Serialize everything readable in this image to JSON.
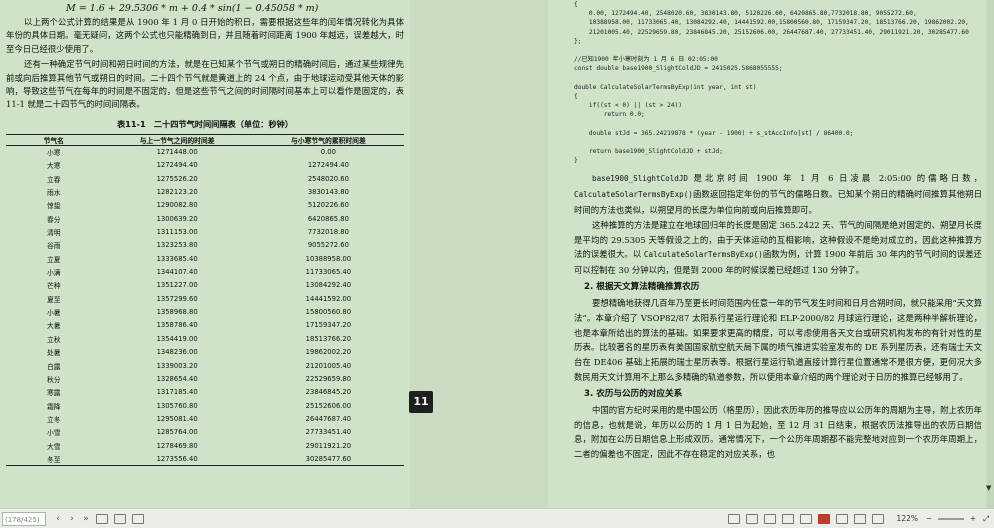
{
  "left_page": {
    "formula": "M = 1.6 + 29.5306 * m + 0.4 * sin(1 − 0.45058 * m)",
    "para1": "以上两个公式计算的结果是从 1900 年 1 月 0 日开始的积日，需要根据这些年的闰年情况转化为具体年份的具体日期。毫无疑问，这两个公式也只能精确到日，并且随着时间距离 1900 年越远，误差越大，时至今日已经很少使用了。",
    "para2": "还有一种确定节气时间和朔日时间的方法，就是在已知某个节气或朔日的精确时间后，通过某些规律先前或向后推算其他节气或朔日的时间。二十四个节气就是黄道上的 24 个点，由于地球运动受其他天体的影响，导致这些节气在每年的时间是不固定的，但是这些节气之间的时间隔时间基本上可以看作是固定的，表 11-1 就是二十四节气的时间间隔表。",
    "table_title": "表11-1　二十四节气时间间隔表（单位：秒钟）",
    "table_headers": [
      "节气名",
      "与上一节气之间的时间差",
      "与小寒节气的累积时间差"
    ],
    "table_rows": [
      [
        "小寒",
        "1271448.00",
        "0.00"
      ],
      [
        "大寒",
        "1272494.40",
        "1272494.40"
      ],
      [
        "立春",
        "1275526.20",
        "2548020.60"
      ],
      [
        "雨水",
        "1282123.20",
        "3830143.80"
      ],
      [
        "惊蛰",
        "1290082.80",
        "5120226.60"
      ],
      [
        "春分",
        "1300639.20",
        "6420865.80"
      ],
      [
        "清明",
        "1311153.00",
        "7732018.80"
      ],
      [
        "谷雨",
        "1323253.80",
        "9055272.60"
      ],
      [
        "立夏",
        "1333685.40",
        "10388958.00"
      ],
      [
        "小满",
        "1344107.40",
        "11733065.40"
      ],
      [
        "芒种",
        "1351227.00",
        "13084292.40"
      ],
      [
        "夏至",
        "1357299.60",
        "14441592.00"
      ],
      [
        "小暑",
        "1358968.80",
        "15800560.80"
      ],
      [
        "大暑",
        "1358786.40",
        "17159347.20"
      ],
      [
        "立秋",
        "1354419.00",
        "18513766.20"
      ],
      [
        "处暑",
        "1348236.00",
        "19862002.20"
      ],
      [
        "白露",
        "1339003.20",
        "21201005.40"
      ],
      [
        "秋分",
        "1328654.40",
        "22529659.80"
      ],
      [
        "寒露",
        "1317185.40",
        "23846845.20"
      ],
      [
        "霜降",
        "1305760.80",
        "25152606.00"
      ],
      [
        "立冬",
        "1295081.40",
        "26447687.40"
      ],
      [
        "小雪",
        "1285764.00",
        "27733451.40"
      ],
      [
        "大雪",
        "1278469.80",
        "29011921.20"
      ],
      [
        "冬至",
        "1273556.40",
        "30285477.60"
      ]
    ]
  },
  "page_badge": "11",
  "right_page": {
    "code_lines": [
      "{",
      "    0.00, 1272494.40, 2548020.60, 3830143.80, 5120226.60, 6420865.80,7732018.80, 9055272.60,",
      "    10388958.00, 11733065.40, 13084292.40, 14441592.00,15800560.80, 17159347.20, 18513766.20, 19862002.20,",
      "    21201005.40, 22529659.80, 23846845.20, 25152606.00, 26447687.40, 27733451.40, 29011921.20, 30285477.60",
      "};",
      "",
      "//已知1900 年小寒时刻为 1 月 6 日 02:05:00",
      "const double base1900_SlightColdJD = 2415025.5868055555;",
      "",
      "double CalculateSolarTermsByExp(int year, int st)",
      "{",
      "    if((st < 0) || (st > 24))",
      "        return 0.0;",
      "",
      "    double stJd = 365.24219878 * (year - 1900) + s_stAccInfo[st] / 86400.0;",
      "",
      "    return base1900_SlightColdJD + stJd;",
      "}"
    ],
    "para1_code": "base1900_SlightColdJD",
    "para1_a": " 是北京时间 1900 年 1 月 6 日凌晨 2:05:00 的儒略日数，",
    "para1_code2": "CalculateSolarTermsByExp()",
    "para1_b": "函数返回指定年份的节气的儒略日数。已知某个朔日的精确时间推算其他朔日时间的方法也类似，以朔望月的长度为单位向前或向后推算即可。",
    "para2_a": "这种推算的方法是建立在地球回归年的长度是固定 365.2422 天、节气的间隔是绝对固定的、朔望月长度是平均的 29.5305 天等假设之上的，由于天体运动的互相影响，这种假设不是绝对成立的，因此这种推算方法的误差很大。以 ",
    "para2_code": "CalculateSolarTermsByExp()",
    "para2_b": "函数为例，计算 1900 年前后 30 年内的节气时间的误差还可以控制在 30 分钟以内，但是到 2000 年的时候误差已经超过 130 分钟了。",
    "section2": "2. 根据天文算法精确推算农历",
    "para3": "要想精确地获得几百年乃至更长时间范围内任意一年的节气发生时间和日月合朔时间，就只能采用“天文算法”。本章介绍了 VSOP82/87 太阳系行星运行理论和 ELP-2000/82 月球运行理论，这是两种半解析理论，也是本章所给出的算法的基础。如果要求更高的精度，可以考虑使用各天文台或研究机构发布的有针对性的星历表。比较著名的星历表有美国国家航空航天局下属的喷气推进实验室发布的 DE 系列星历表，还有瑞士天文台在 DE406 基础上拓展的瑞士星历表等。根据行星运行轨道直接计算行星位置通常不是很方便，更何况大多数民用天文计算用不上那么多精确的轨道参数，所以使用本章介绍的两个理论对于日历的推算已经够用了。",
    "section3": "3. 农历与公历的对应关系",
    "para4": "中国的官方纪时采用的是中国公历（格里历），因此农历年历的推导应以公历年的周期为主导，附上农历年的信息，也就是说，年历以公历的 1 月 1 日为起始，至 12 月 31 日结束，根据农历法推导出的农历日期信息，附加在公历日期信息上形成双历。通常情况下，一个公历年周期都不能完整地对应到一个农历年周期上，二者的偏差也不固定，因此不存在稳定的对应关系，也"
  },
  "statusbar": {
    "page_number": "(178/425)",
    "zoom_level": "122%",
    "zoom_minus": "−",
    "zoom_plus": "+",
    "nav_prev": "‹",
    "nav_next": "›",
    "nav_last": "»"
  }
}
